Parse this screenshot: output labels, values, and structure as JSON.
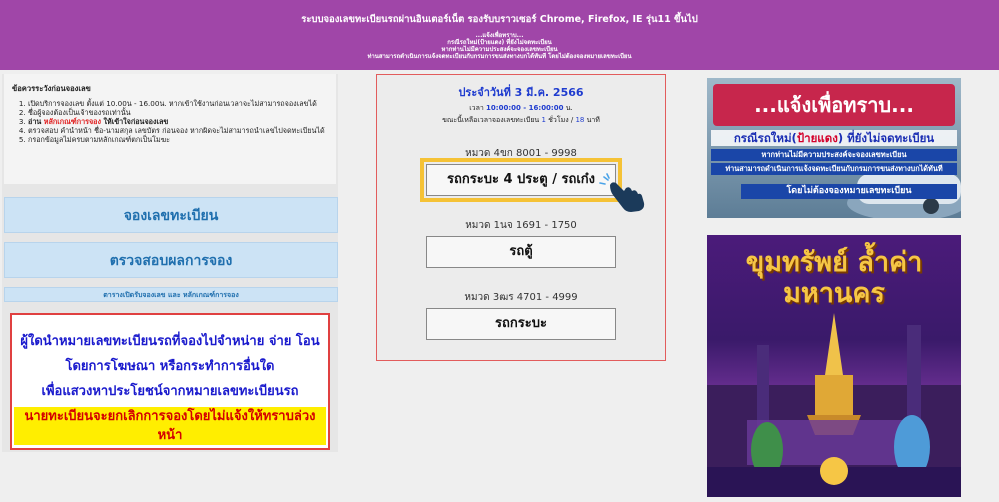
{
  "header": {
    "title": "ระบบจองเลขทะเบียนรถผ่านอินเตอร์เน็ต รองรับบราวเซอร์ Chrome, Firefox, IE รุ่น11 ขึ้นไป",
    "line1": "...แจ้งเพื่อทราบ...",
    "line2": "กรณีรถใหม่(ป้ายแดง) ที่ยังไม่จดทะเบียน",
    "line3": "หากท่านไม่มีความประสงค์จะจองเลขทะเบียน",
    "line4": "ท่านสามารถดำเนินการแจ้งจดทะเบียนกับกรมการขนส่งทางบกได้ทันที โดยไม่ต้องจองหมายเลขทะเบียน"
  },
  "notice": {
    "title": "ข้อควรระวังก่อนจองเลข",
    "item1": "เปิดบริการจองเลข ตั้งแต่ 10.00น - 16.00น. หากเข้าใช้งานก่อนเวลาจะไม่สามารถจองเลขได้",
    "item2": "ชื่อผู้จองต้องเป็นเจ้าของรถเท่านั้น",
    "item3_a": "อ่าน ",
    "item3_b": "หลักเกณฑ์การจอง",
    "item3_c": " ให้เข้าใจก่อนจองเลข",
    "item4": "ตรวจสอบ คำนำหน้า ชื่อ-นามสกุล เลขบัตร ก่อนจอง หากผิดจะไม่สามารถนำเลขไปจดทะเบียนได้",
    "item5": "กรอกข้อมูลไม่ครบตามหลักเกณฑ์ตกเป็นโมฆะ"
  },
  "menu": {
    "reserve": "จองเลขทะเบียน",
    "check": "ตรวจสอบผลการจอง",
    "schedule": "ตารางเปิดรับจองเลข และ หลักเกณฑ์การจอง"
  },
  "warning": {
    "line1": "ผู้ใดนำหมายเลขทะเบียนรถที่จองไปจำหน่าย จ่าย โอน",
    "line2": "โดยการโฆษณา หรือกระทำการอื่นใด",
    "line3": "เพื่อแสวงหาประโยชน์จากหมายเลขทะเบียนรถ",
    "line4": "นายทะเบียนจะยกเลิกการจองโดยไม่แจ้งให้ทราบล่วงหน้า"
  },
  "booking": {
    "date": "ประจำวันที่ 3 มี.ค. 2566",
    "time_prefix": "เวลา ",
    "time_value": "10:00:00 - 16:00:00",
    "time_suffix": " น.",
    "remain_prefix": "ขณะนี้เหลือเวลาจองเลขทะเบียน ",
    "remain_hours": "1",
    "remain_mid": " ชั่วโมง / ",
    "remain_minutes": "18",
    "remain_suffix": " นาที",
    "categories": [
      {
        "label": "หมวด 4ขก 8001 - 9998",
        "button": "รถกระบะ 4 ประตู / รถเก๋ง"
      },
      {
        "label": "หมวด 1นจ 1691 - 1750",
        "button": "รถตู้"
      },
      {
        "label": "หมวด 3ฒร 4701 - 4999",
        "button": "รถกระบะ"
      }
    ]
  },
  "ad1": {
    "banner": "...แจ้งเพื่อทราบ...",
    "line1_a": "กรณีรถใหม่(",
    "line1_b": "ป้ายแดง",
    "line1_c": ") ที่ยังไม่จดทะเบียน",
    "line2": "หากท่านไม่มีความประสงค์จะจองเลขทะเบียน",
    "line3": "ท่านสามารถดำเนินการแจ้งจดทะเบียนกับกรมการขนส่งทางบกได้ทันที",
    "line4": "โดยไม่ต้องจองหมายเลขทะเบียน"
  },
  "ad2": {
    "title_line1": "ขุมทรัพย์ ล้ำค่า",
    "title_line2": "มหานคร"
  },
  "icons": {
    "hand": "pointing-hand-icon"
  }
}
